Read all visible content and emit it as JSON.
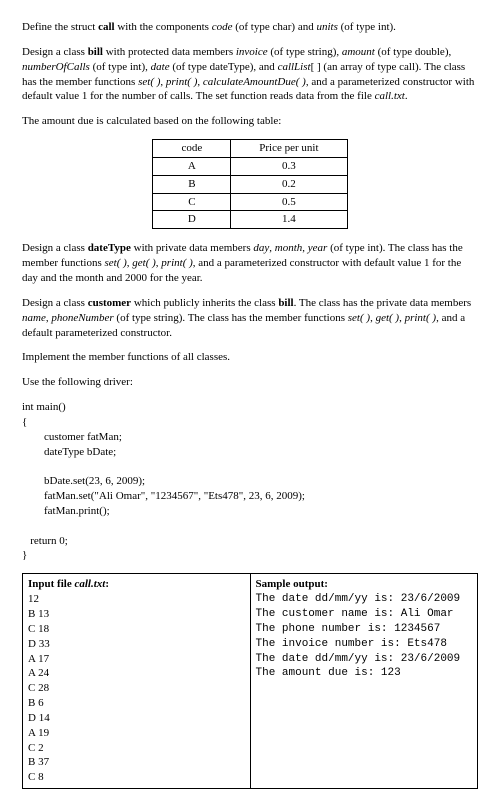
{
  "para1_a": "Define the struct ",
  "para1_b": "call",
  "para1_c": " with the components ",
  "para1_d": "code",
  "para1_e": " (of type char) and ",
  "para1_f": "units",
  "para1_g": " (of type int).",
  "para2_a": "Design a class ",
  "para2_b": "bill",
  "para2_c": " with protected data members ",
  "para2_d": "invoice",
  "para2_e": " (of type string), ",
  "para2_f": "amount",
  "para2_g": " (of type double), ",
  "para2_h": "numberOfCalls",
  "para2_i": " (of type int), ",
  "para2_j": "date",
  "para2_k": " (of type dateType), and ",
  "para2_l": "callList",
  "para2_m": "[ ] (an array of type call). The class has the member functions ",
  "para2_n": "set( )",
  "para2_o": ", ",
  "para2_p": "print( )",
  "para2_q": ", ",
  "para2_r": "calculateAmountDue( )",
  "para2_s": ", and a parameterized constructor with default value 1 for the number of calls. The set function reads data from the file ",
  "para2_t": "call.txt",
  "para2_u": ".",
  "para3": "The amount due is calculated based on the following table:",
  "thead_code": "code",
  "thead_price": "Price per unit",
  "trows": [
    {
      "c": "A",
      "p": "0.3"
    },
    {
      "c": "B",
      "p": "0.2"
    },
    {
      "c": "C",
      "p": "0.5"
    },
    {
      "c": "D",
      "p": "1.4"
    }
  ],
  "para4_a": "Design a class ",
  "para4_b": "dateType",
  "para4_c": " with private data members ",
  "para4_d": "day",
  "para4_e": ", ",
  "para4_f": "month",
  "para4_g": ", ",
  "para4_h": "year",
  "para4_i": " (of type int). The class has the member functions ",
  "para4_j": "set( )",
  "para4_k": ", ",
  "para4_l": "get( )",
  "para4_m": ", ",
  "para4_n": "print( )",
  "para4_o": ", and a parameterized constructor with default value 1 for the day and the month and  2000 for the year.",
  "para5_a": "Design a class ",
  "para5_b": "customer",
  "para5_c": " which publicly inherits the class ",
  "para5_d": "bill",
  "para5_e": ". The class has the private data members ",
  "para5_f": "name",
  "para5_g": ", ",
  "para5_h": "phoneNumber",
  "para5_i": " (of type string). The class has the member functions ",
  "para5_j": "set( )",
  "para5_k": ", ",
  "para5_l": "get( )",
  "para5_m": ", ",
  "para5_n": "print( )",
  "para5_o": ", and a default parameterized constructor.",
  "para6": "Implement the member functions of all classes.",
  "para7": "Use the following driver:",
  "code": "int main()\n{\n        customer fatMan;\n        dateType bDate;\n\n        bDate.set(23, 6, 2009);\n        fatMan.set(\"Ali Omar\", \"1234567\", \"Ets478\", 23, 6, 2009);\n        fatMan.print();\n\n   return 0;\n}",
  "io_input_head_a": "Input file ",
  "io_input_head_b": "call.txt",
  "io_input_head_c": ":",
  "io_input_body": "12\nB 13\nC 18\nD 33\nA 17\nA 24\nC 28\nB 6\nD 14\nA 19\nC 2\nB 37\nC 8",
  "io_output_head": "Sample output:",
  "io_output_body": "The date dd/mm/yy is: 23/6/2009\nThe customer name is: Ali Omar\nThe phone number is: 1234567\nThe invoice number is: Ets478\nThe date dd/mm/yy is: 23/6/2009\nThe amount due is: 123"
}
